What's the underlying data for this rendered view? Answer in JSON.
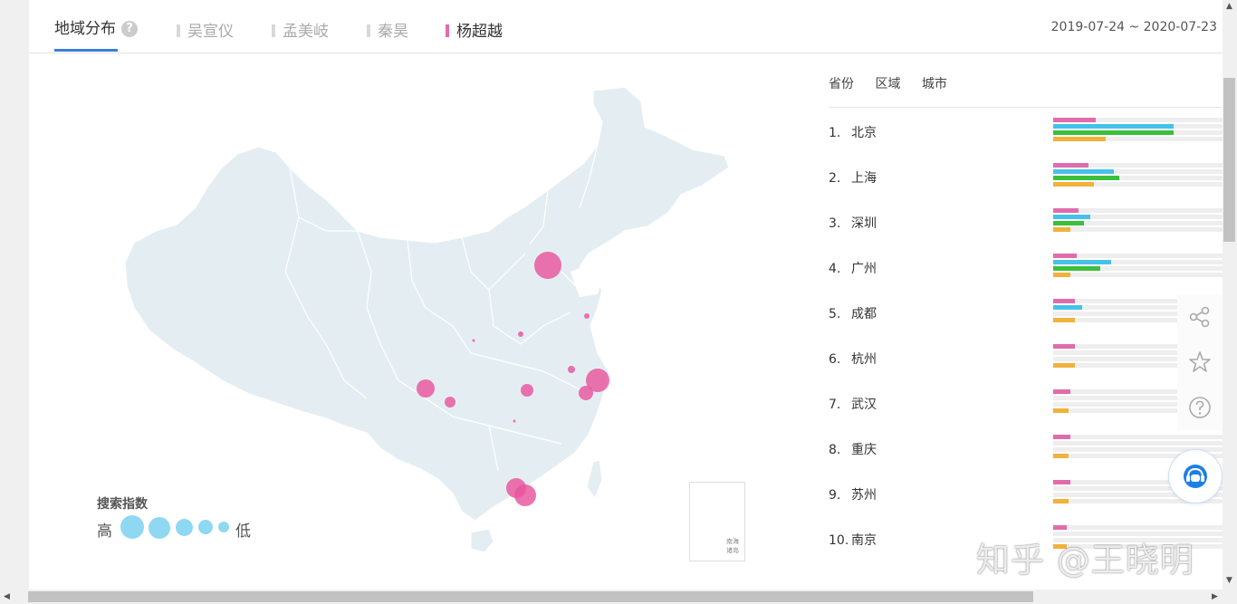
{
  "header": {
    "main_tab": "地域分布",
    "help_glyph": "?",
    "date_range": "2019-07-24 ~ 2020-07-23",
    "keywords": [
      {
        "label": "吴宣仪",
        "color": "#d8d8d8",
        "active": false
      },
      {
        "label": "孟美岐",
        "color": "#d8d8d8",
        "active": false
      },
      {
        "label": "秦昊",
        "color": "#d8d8d8",
        "active": false
      },
      {
        "label": "杨超越",
        "color": "#e06cad",
        "active": true
      }
    ]
  },
  "subtabs": [
    "省份",
    "区域",
    "城市"
  ],
  "series_colors": [
    "#e06cad",
    "#45c2e8",
    "#3cbf3c",
    "#f0b23c"
  ],
  "ranking": [
    {
      "num": "1.",
      "city": "北京",
      "values": [
        0.25,
        0.71,
        0.71,
        0.31
      ]
    },
    {
      "num": "2.",
      "city": "上海",
      "values": [
        0.21,
        0.36,
        0.39,
        0.24
      ]
    },
    {
      "num": "3.",
      "city": "深圳",
      "values": [
        0.15,
        0.22,
        0.18,
        0.1
      ]
    },
    {
      "num": "4.",
      "city": "广州",
      "values": [
        0.14,
        0.34,
        0.28,
        0.1
      ]
    },
    {
      "num": "5.",
      "city": "成都",
      "values": [
        0.13,
        0.17,
        null,
        0.13
      ]
    },
    {
      "num": "6.",
      "city": "杭州",
      "values": [
        0.13,
        null,
        null,
        0.13
      ]
    },
    {
      "num": "7.",
      "city": "武汉",
      "values": [
        0.1,
        null,
        null,
        0.09
      ]
    },
    {
      "num": "8.",
      "city": "重庆",
      "values": [
        0.1,
        null,
        null,
        0.09
      ]
    },
    {
      "num": "9.",
      "city": "苏州",
      "values": [
        0.1,
        null,
        null,
        0.09
      ]
    },
    {
      "num": "10.",
      "city": "南京",
      "values": [
        0.08,
        null,
        null,
        0.08
      ]
    }
  ],
  "legend": {
    "title": "搜索指数",
    "high": "高",
    "low": "低"
  },
  "inset_label": "南海诸岛",
  "watermark": "知乎 @王晓明",
  "scroll": {
    "left": "◀",
    "right": "▶",
    "up": "▲",
    "down": "▼"
  }
}
